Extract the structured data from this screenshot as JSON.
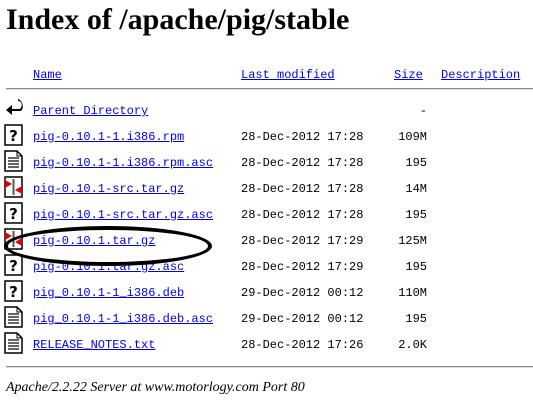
{
  "page": {
    "title": "Index of /apache/pig/stable"
  },
  "columns": {
    "name": "Name",
    "modified": "Last modified",
    "size": "Size",
    "description": "Description"
  },
  "rows": [
    {
      "icon": "back-icon",
      "name": "Parent Directory",
      "modified": "",
      "size": "-"
    },
    {
      "icon": "unknown-file-icon",
      "name": "pig-0.10.1-1.i386.rpm",
      "modified": "28-Dec-2012 17:28",
      "size": "109M"
    },
    {
      "icon": "text-file-icon",
      "name": "pig-0.10.1-1.i386.rpm.asc",
      "modified": "28-Dec-2012 17:28",
      "size": "195"
    },
    {
      "icon": "compressed-file-icon",
      "name": "pig-0.10.1-src.tar.gz",
      "modified": "28-Dec-2012 17:28",
      "size": "14M"
    },
    {
      "icon": "unknown-file-icon",
      "name": "pig-0.10.1-src.tar.gz.asc",
      "modified": "28-Dec-2012 17:28",
      "size": "195"
    },
    {
      "icon": "compressed-file-icon",
      "name": "pig-0.10.1.tar.gz",
      "modified": "28-Dec-2012 17:29",
      "size": "125M"
    },
    {
      "icon": "unknown-file-icon",
      "name": "pig-0.10.1.tar.gz.asc",
      "modified": "28-Dec-2012 17:29",
      "size": "195"
    },
    {
      "icon": "unknown-file-icon",
      "name": "pig_0.10.1-1_i386.deb",
      "modified": "29-Dec-2012 00:12",
      "size": "110M"
    },
    {
      "icon": "text-file-icon",
      "name": "pig_0.10.1-1_i386.deb.asc",
      "modified": "29-Dec-2012 00:12",
      "size": "195"
    },
    {
      "icon": "text-file-icon",
      "name": "RELEASE_NOTES.txt",
      "modified": "28-Dec-2012 17:26",
      "size": "2.0K"
    }
  ],
  "footer": {
    "text": "Apache/2.2.22 Server at www.motorlogy.com Port 80"
  },
  "highlight": {
    "row_name": "pig-0.10.1.tar.gz",
    "color": "#000000"
  }
}
